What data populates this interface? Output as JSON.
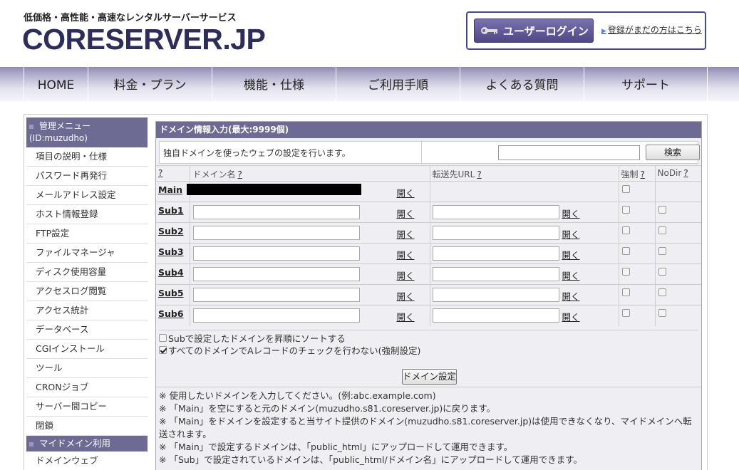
{
  "header": {
    "tagline": "低価格・高性能・高速なレンタルサーバーサービス",
    "logo": "CORESERVER.JP",
    "login_button": "ユーザーログイン",
    "register_link": "登録がまだの方はこちら"
  },
  "nav": [
    "HOME",
    "料金・プラン",
    "機能・仕様",
    "ご利用手順",
    "よくある質問",
    "サポート"
  ],
  "sidebar": {
    "heading_line1": "管理メニュー",
    "heading_line2": "(ID:muzudho)",
    "items": [
      "項目の説明・仕様",
      "パスワード再発行",
      "メールアドレス設定",
      "ホスト情報登録",
      "FTP設定",
      "ファイルマネージャ",
      "ディスク使用容量",
      "アクセスログ閲覧",
      "アクセス統計",
      "データベース",
      "CGIインストール",
      "ツール",
      "CRONジョブ",
      "サーバー間コピー",
      "閉鎖"
    ],
    "section2": "マイドメイン利用",
    "items2": [
      "ドメインウェブ"
    ]
  },
  "panel": {
    "title": "ドメイン情報入力(最大:9999個)",
    "description": "独自ドメインを使ったウェブの設定を行います。",
    "search_button": "検索",
    "search_value": "",
    "columns": {
      "help": "?",
      "domain": "ドメイン名",
      "forward": "転送先URL",
      "force": "強制",
      "nodir": "NoDir"
    },
    "open_label": "開く",
    "rows": [
      {
        "name": "Main",
        "domain": "",
        "forward": ""
      },
      {
        "name": "Sub1",
        "domain": "",
        "forward": ""
      },
      {
        "name": "Sub2",
        "domain": "",
        "forward": ""
      },
      {
        "name": "Sub3",
        "domain": "",
        "forward": ""
      },
      {
        "name": "Sub4",
        "domain": "",
        "forward": ""
      },
      {
        "name": "Sub5",
        "domain": "",
        "forward": ""
      },
      {
        "name": "Sub6",
        "domain": "",
        "forward": ""
      }
    ],
    "option_sort": "Subで設定したドメインを昇順にソートする",
    "option_no_a_check": "すべてのドメインでAレコードのチェックを行わない(強制設定)",
    "submit_button": "ドメイン設定",
    "notes": [
      "※ 使用したいドメインを入力してください。(例:abc.example.com)",
      "※ 「Main」を空にすると元のドメイン(muzudho.s81.coreserver.jp)に戻ります。",
      "※ 「Main」をドメインを設定すると当サイト提供のドメイン(muzudho.s81.coreserver.jp)は使用できなくなり、マイドメインへ転送されます。",
      "※ 「Main」で設定するドメインは、「public_html」にアップロードして運用できます。",
      "※ 「Sub」で設定されているドメインは、「public_html/ドメイン名」にアップロードして運用できます。"
    ]
  }
}
